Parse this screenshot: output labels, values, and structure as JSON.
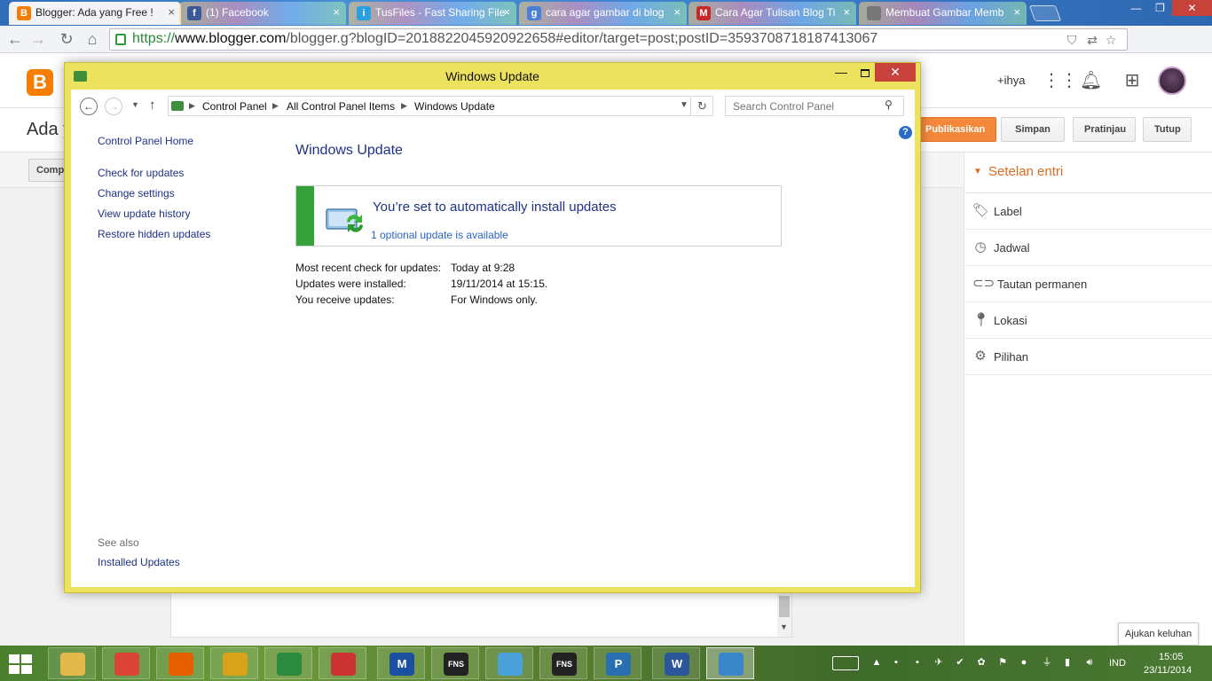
{
  "browser": {
    "tabs": [
      {
        "title": "Blogger: Ada yang Free !",
        "icon_text": "B",
        "color": "#f57d00"
      },
      {
        "title": "(1) Facebook",
        "icon_text": "f",
        "color": "#3b5998"
      },
      {
        "title": "TusFiles - Fast Sharing File",
        "icon_text": "i",
        "color": "#2aa0e0"
      },
      {
        "title": "cara agar gambar di blog",
        "icon_text": "g",
        "color": "#4a7fd4"
      },
      {
        "title": "Cara Agar Tulisan Blog Ti",
        "icon_text": "M",
        "color": "#c62828"
      },
      {
        "title": "Membuat Gambar Memb",
        "icon_text": "",
        "color": "#777777"
      }
    ],
    "url_scheme": "https://",
    "url_host": "www.blogger.com",
    "url_path": "/blogger.g?blogID=2018822045920922658#editor/target=post;postID=3593708718187413067"
  },
  "blogger": {
    "user": "+ihya",
    "post_title": "Ada y",
    "compose_label": "Comp",
    "buttons": {
      "publish": "Publikasikan",
      "save": "Simpan",
      "preview": "Pratinjau",
      "close": "Tutup"
    },
    "settings_title": "Setelan entri",
    "settings_items": [
      {
        "label": "Label",
        "icon": "tag-icon"
      },
      {
        "label": "Jadwal",
        "icon": "clock-icon"
      },
      {
        "label": "Tautan permanen",
        "icon": "link-icon"
      },
      {
        "label": "Lokasi",
        "icon": "location-icon"
      },
      {
        "label": "Pilihan",
        "icon": "gear-icon"
      }
    ],
    "feedback": "Ajukan keluhan"
  },
  "windows_update": {
    "window_title": "Windows Update",
    "breadcrumb": [
      "Control Panel",
      "All Control Panel Items",
      "Windows Update"
    ],
    "search_placeholder": "Search Control Panel",
    "left_nav": [
      "Control Panel Home",
      "Check for updates",
      "Change settings",
      "View update history",
      "Restore hidden updates"
    ],
    "see_also": "See also",
    "installed_updates": "Installed Updates",
    "heading": "Windows Update",
    "status_message": "You’re set to automatically install updates",
    "optional_link": "1 optional update is available",
    "info": [
      {
        "label": "Most recent check for updates:",
        "value": "Today at 9:28"
      },
      {
        "label": "Updates were installed:",
        "value": "19/11/2014 at 15:15."
      },
      {
        "label": "You receive updates:",
        "value": "For Windows only."
      }
    ]
  },
  "taskbar": {
    "apps": [
      {
        "name": "file-explorer",
        "glyph": "",
        "color": "#e2b94a"
      },
      {
        "name": "chrome",
        "glyph": "",
        "color": "#db4437"
      },
      {
        "name": "firefox",
        "glyph": "",
        "color": "#e66000"
      },
      {
        "name": "app-4",
        "glyph": "",
        "color": "#d9a21b"
      },
      {
        "name": "internet-download-manager",
        "glyph": "",
        "color": "#2b8a3e"
      },
      {
        "name": "app-6",
        "glyph": "",
        "color": "#cc3333"
      },
      {
        "name": "app-m",
        "glyph": "M",
        "color": "#1b4fa0"
      },
      {
        "name": "app-fns",
        "glyph": "FNS",
        "color": "#222222"
      },
      {
        "name": "app-pen",
        "glyph": "",
        "color": "#4aa0d8"
      },
      {
        "name": "app-fns-2",
        "glyph": "FNS",
        "color": "#222222"
      },
      {
        "name": "app-p",
        "glyph": "P",
        "color": "#2a6fb0"
      },
      {
        "name": "word",
        "glyph": "W",
        "color": "#2b579a"
      },
      {
        "name": "control-panel",
        "glyph": "",
        "color": "#3a86c8"
      }
    ],
    "language": "IND",
    "time": "15:05",
    "date": "23/11/2014"
  }
}
